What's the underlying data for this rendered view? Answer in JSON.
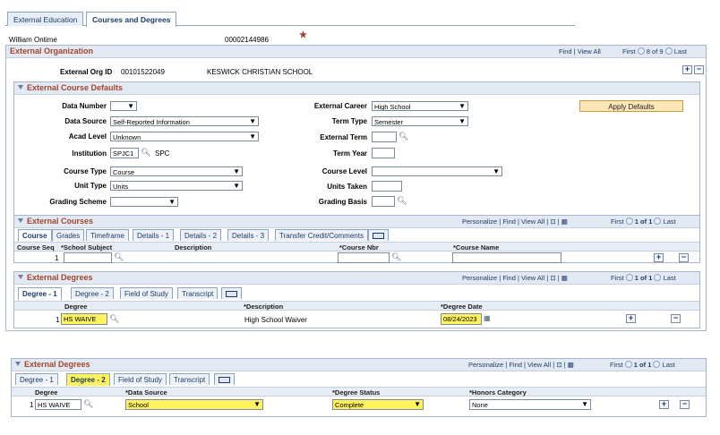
{
  "tabs": [
    {
      "label": "External Education",
      "active": false
    },
    {
      "label": "Courses and Degrees",
      "active": true
    }
  ],
  "person": {
    "name": "William Ontime",
    "id": "00002144986",
    "star": "★"
  },
  "org_section": {
    "title": "External Organization",
    "find": "Find",
    "view_all": "View All",
    "first": "First",
    "count": "8 of 9",
    "last": "Last",
    "org_id_label": "External Org ID",
    "org_id": "00101522049",
    "org_name": "KESWICK CHRISTIAN SCHOOL"
  },
  "defaults": {
    "title": "External Course Defaults",
    "data_number_label": "Data Number",
    "data_number": "",
    "data_source_label": "Data Source",
    "data_source": "Self-Reported Information",
    "acad_level_label": "Acad Level",
    "acad_level": "Unknown",
    "institution_label": "Institution",
    "institution": "SPJC1",
    "institution_desc": "SPC",
    "course_type_label": "Course Type",
    "course_type": "Course",
    "unit_type_label": "Unit Type",
    "unit_type": "Units",
    "grading_scheme_label": "Grading Scheme",
    "grading_scheme": "",
    "ext_career_label": "External Career",
    "ext_career": "High School",
    "term_type_label": "Term Type",
    "term_type": "Semester",
    "ext_term_label": "External Term",
    "ext_term": "",
    "term_year_label": "Term Year",
    "term_year": "",
    "course_level_label": "Course Level",
    "course_level": "",
    "units_taken_label": "Units Taken",
    "units_taken": "",
    "grading_basis_label": "Grading Basis",
    "grading_basis": "",
    "apply_button": "Apply Defaults"
  },
  "courses": {
    "title": "External Courses",
    "personalize": "Personalize",
    "find": "Find",
    "view_all": "View All",
    "first": "First",
    "count": "1 of 1",
    "last": "Last",
    "subtabs": [
      "Course",
      "Grades",
      "Timeframe",
      "Details - 1",
      "Details - 2",
      "Details - 3",
      "Transfer Credit/Comments"
    ],
    "columns": [
      "Course Seq",
      "*School Subject",
      "Description",
      "*Course Nbr",
      "*Course Name"
    ],
    "row": {
      "seq": "1",
      "subject": "",
      "description": "",
      "course_nbr": "",
      "course_name": ""
    }
  },
  "degrees": {
    "title": "External Degrees",
    "personalize": "Personalize",
    "find": "Find",
    "view_all": "View All",
    "first": "First",
    "count": "1 of 1",
    "last": "Last",
    "subtabs": [
      "Degree - 1",
      "Degree - 2",
      "Field of Study",
      "Transcript"
    ],
    "columns": [
      "Degree",
      "*Description",
      "*Degree Date"
    ],
    "row": {
      "seq": "1",
      "degree": "HS WAIVE",
      "description": "High School Waiver",
      "date": "08/24/2023"
    }
  },
  "degrees2": {
    "title": "External Degrees",
    "personalize": "Personalize",
    "find": "Find",
    "view_all": "View All",
    "first": "First",
    "count": "1 of 1",
    "last": "Last",
    "subtabs": [
      "Degree - 1",
      "Degree - 2",
      "Field of Study",
      "Transcript"
    ],
    "columns": [
      "Degree",
      "*Data Source",
      "*Degree Status",
      "*Honors Category"
    ],
    "row": {
      "seq": "1",
      "degree": "HS WAIVE",
      "data_source": "School",
      "status": "Complete",
      "honors": "None"
    }
  },
  "colors": {
    "highlight": "#fff35c",
    "section_title": "#a0462a",
    "link": "#1b3a6b"
  }
}
